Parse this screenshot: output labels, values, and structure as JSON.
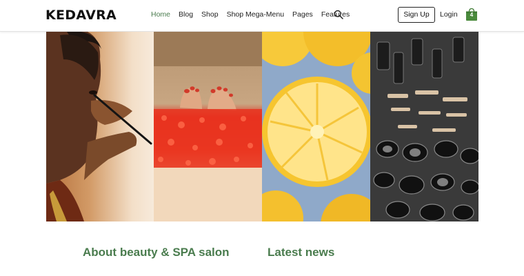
{
  "brand": {
    "logo": "KEDAVRA",
    "accent": "#4a7c4e"
  },
  "nav": {
    "items": [
      {
        "label": "Home",
        "active": true
      },
      {
        "label": "Blog",
        "active": false
      },
      {
        "label": "Shop",
        "active": false
      },
      {
        "label": "Shop Mega-Menu",
        "active": false
      },
      {
        "label": "Pages",
        "active": false
      },
      {
        "label": "Features",
        "active": false
      }
    ],
    "search_icon": "search-icon"
  },
  "account": {
    "signup_label": "Sign Up",
    "login_label": "Login"
  },
  "cart": {
    "icon": "shopping-bag-icon",
    "count": "4",
    "color": "#4a8a3c"
  },
  "hero": {
    "panels": [
      {
        "subject": "woman applying eyeliner"
      },
      {
        "subject": "feet in spa bath with red petals"
      },
      {
        "subject": "lemon slices"
      },
      {
        "subject": "makeup products"
      }
    ]
  },
  "sections": {
    "about_title": "About beauty & SPA salon",
    "news_title": "Latest news"
  }
}
